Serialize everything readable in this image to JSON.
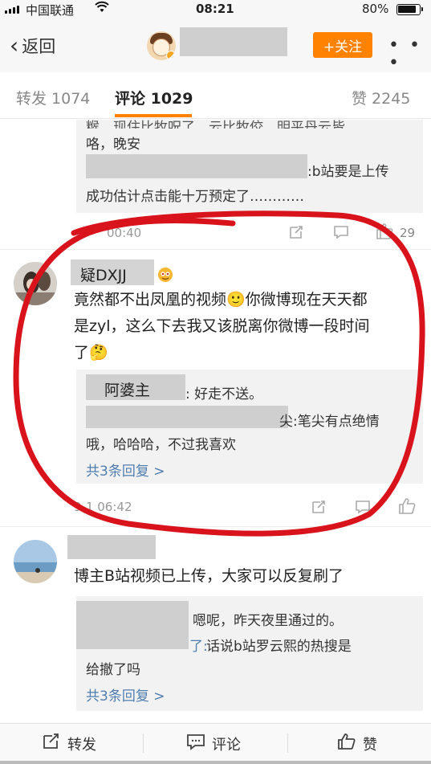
{
  "status_bar": {
    "carrier": "中国联通",
    "time": "08:21",
    "battery": "80%",
    "wifi_icon": "wifi-icon",
    "signal_icon": "signal-icon"
  },
  "nav": {
    "back_label": "返回",
    "follow_label": "+关注",
    "more_label": "• • •"
  },
  "tabs": {
    "repost": "转发 1074",
    "comments": "评论 1029",
    "likes": "赞 2245"
  },
  "comment1": {
    "top_fragment": "糇，现住比牧呪了，云比牧佼，明平丹云皆",
    "line2": "咯，晚安",
    "reply_tail": ":b站要是上传",
    "reply_line2": "成功估计点击能十万预定了…………",
    "time": "00:40",
    "like_count": "29"
  },
  "comment2": {
    "username": "疑DXJJ",
    "line1": "竟然都不出凤凰的视频🙂你微博现在天天都",
    "line2": "是zyl，这么下去我又该脱离你微博一段时间",
    "line3": "了🤔",
    "reply1_name": "阿婆主",
    "reply1_text": ": 好走不送。",
    "reply2_tail": "尖:笔尖有点绝情",
    "reply2_line2": "哦，哈哈哈，不过我喜欢",
    "more_replies": "共3条回复 >",
    "time": "9-1  06:42"
  },
  "comment3": {
    "line1": "博主B站视频已上传，大家可以反复刷了",
    "reply1_text": "嗯呢，昨天夜里通过的。",
    "reply2_tail": "了:",
    "reply2_text": " 话说b站罗云熙的热搜是",
    "reply2_line2": "给撤了吗",
    "more_replies": "共3条回复 >"
  },
  "bottom_bar": {
    "repost": "转发",
    "comment": "评论",
    "like": "赞"
  },
  "colors": {
    "accent": "#ff8200",
    "link": "#507daf",
    "annotation": "#d9131c"
  }
}
